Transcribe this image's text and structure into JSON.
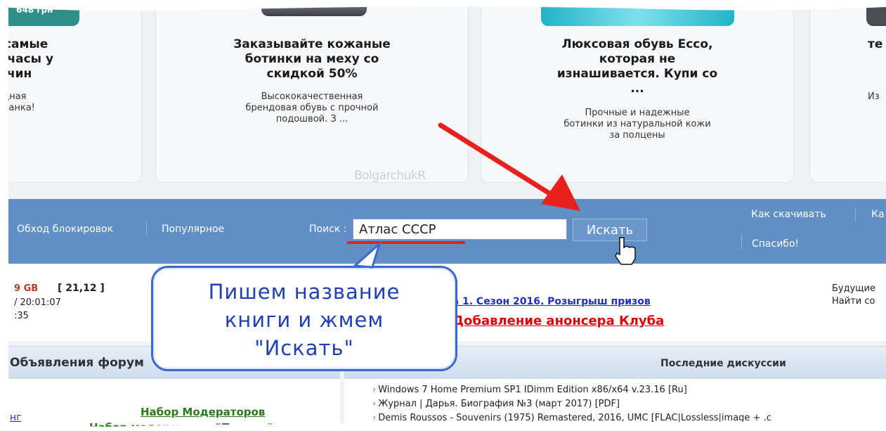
{
  "ads": [
    {
      "badge": "648 грн",
      "title_lines": [
        "- самые",
        "е часы у",
        "жчин"
      ],
      "desc_lines": [
        "ощная",
        "у танка!",
        "%"
      ]
    },
    {
      "title_lines": [
        "Заказывайте кожаные",
        "ботинки на меху со",
        "скидкой 50%"
      ],
      "desc_lines": [
        "Высококачественная",
        "брендовая обувь с прочной",
        "подошвой. З ..."
      ]
    },
    {
      "title_lines": [
        "Люксовая обувь Ecco,",
        "которая не",
        "изнашивается. Купи со",
        "..."
      ],
      "desc_lines": [
        "Прочные и надежные",
        "ботинки из натуральной кожи",
        "за полцены"
      ]
    },
    {
      "title_lines": [
        "",
        "",
        "те"
      ],
      "desc_lines": [
        "Из"
      ]
    }
  ],
  "watermark": "BolgarchukR",
  "nav": {
    "links": [
      "Обход блокировок",
      "Популярное"
    ],
    "right_links": [
      "Как скачивать",
      "Ка",
      "Спасибо!"
    ]
  },
  "search": {
    "label": "Поиск :",
    "value": "Атлас СССР",
    "button": "Искать"
  },
  "stats": {
    "size": "9 GB",
    "ratio": "[ 21,12 ]",
    "date": "/ 20:01:07",
    "time": ":35"
  },
  "forum_links": {
    "season": "на 1. Сезон 2016. Розыгрыш призов",
    "announcer": "Добавление анонсера Клуба"
  },
  "right_info": [
    "Будущие",
    "Найти со"
  ],
  "callout_lines": [
    "Пишем название",
    "книги и жмем",
    "\"Искать\""
  ],
  "panels": {
    "left_title": "Объявления форум",
    "right_title": "Последние дискуссии",
    "left_items": [
      "нг",
      "Набор Модераторов",
      "Набор модераторов \"Пр...мы\""
    ],
    "discussions": [
      "Windows 7 Home Premium SP1 IDimm Edition x86/x64 v.23.16 [Ru]",
      "Журнал | Дарья. Биография №3 (март 2017) [PDF]",
      "Demis Roussos - Souvenirs (1975) Remastered, 2016, UMC [FLAC|Lossless|image + .c"
    ]
  },
  "colors": {
    "navbar": "#5f8fc5",
    "callout_border": "#3a6ad0",
    "arrow": "#e8201e"
  }
}
